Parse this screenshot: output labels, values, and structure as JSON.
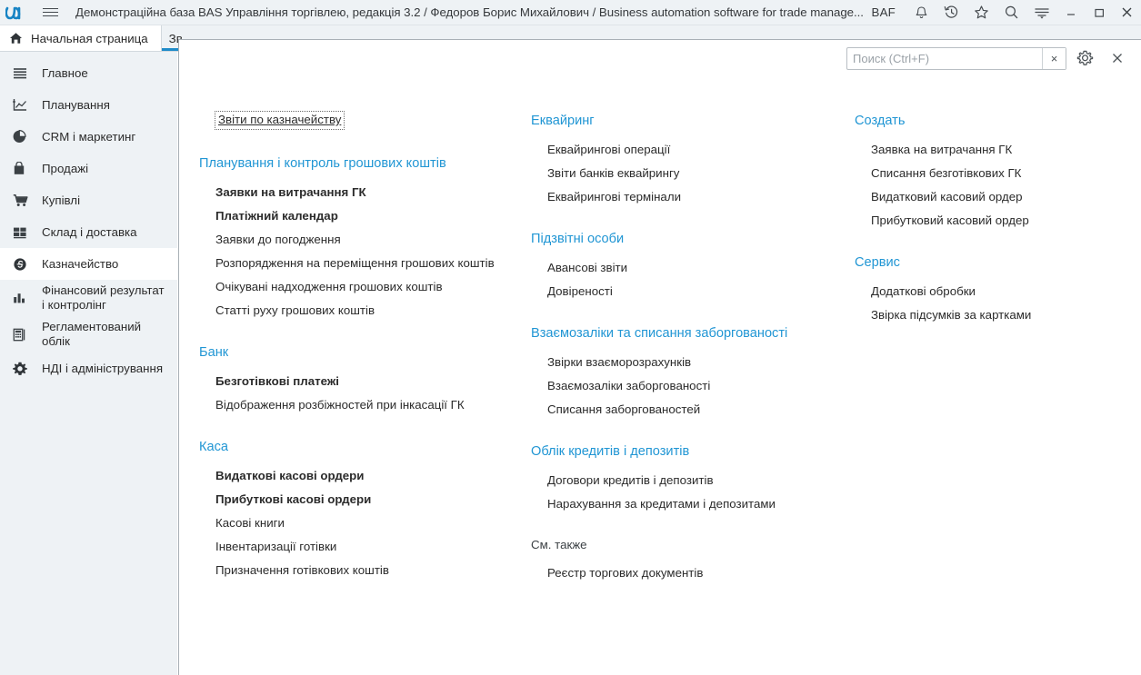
{
  "titlebar": {
    "logo_icon": "bas-logo-icon",
    "menu_icon": "hamburger-menu-icon",
    "title": "Демонстраційна база BAS Управління торгівлею, редакція 3.2 / Федоров Борис Михайлович / Business automation software for trade manage...",
    "user_initials": "BAF",
    "icons": [
      {
        "name": "notifications-bell-icon",
        "glyph": "bell"
      },
      {
        "name": "history-clock-icon",
        "glyph": "clock"
      },
      {
        "name": "favorites-star-icon",
        "glyph": "star"
      },
      {
        "name": "search-icon",
        "glyph": "search"
      },
      {
        "name": "menu-functions-icon",
        "glyph": "lines"
      }
    ],
    "window_buttons": [
      {
        "name": "minimize-button",
        "glyph": "minimize"
      },
      {
        "name": "maximize-button",
        "glyph": "maximize"
      },
      {
        "name": "close-button",
        "glyph": "close"
      }
    ]
  },
  "tabs": [
    {
      "label": "Начальная страница",
      "icon": "home-icon",
      "active": false
    },
    {
      "label": "Зв",
      "icon": "",
      "active": true
    }
  ],
  "sidebar": {
    "items": [
      {
        "label": "Главное",
        "icon": "list-lines-icon",
        "active": false
      },
      {
        "label": "Планування",
        "icon": "chart-trend-icon",
        "active": false
      },
      {
        "label": "CRM і маркетинг",
        "icon": "pie-chart-icon",
        "active": false
      },
      {
        "label": "Продажі",
        "icon": "shopping-bag-icon",
        "active": false
      },
      {
        "label": "Купівлі",
        "icon": "shopping-cart-icon",
        "active": false
      },
      {
        "label": "Склад і доставка",
        "icon": "grid-blocks-icon",
        "active": false
      },
      {
        "label": "Казначейство",
        "icon": "currency-coin-icon",
        "active": true
      },
      {
        "label": "Фінансовий результат і контролінг",
        "icon": "bar-chart-icon",
        "active": false
      },
      {
        "label": "Регламентований облік",
        "icon": "calculator-icon",
        "active": false
      },
      {
        "label": "НДІ і адміністрування",
        "icon": "gear-icon",
        "active": false
      }
    ]
  },
  "panel": {
    "search": {
      "placeholder": "Поиск (Ctrl+F)",
      "value": "",
      "clear_label": "×"
    },
    "settings_icon": "gear-icon",
    "close_label": "×",
    "focus_link": "Звіти по казначейству",
    "columns": [
      {
        "groups": [
          {
            "title": "Планування і контроль грошових коштів",
            "plain": false,
            "items": [
              {
                "label": "Заявки на витрачання ГК",
                "bold": true
              },
              {
                "label": "Платіжний календар",
                "bold": true
              },
              {
                "label": "Заявки до погодження",
                "bold": false
              },
              {
                "label": "Розпорядження на переміщення грошових коштів",
                "bold": false
              },
              {
                "label": "Очікувані надходження грошових коштів",
                "bold": false
              },
              {
                "label": "Статті руху грошових коштів",
                "bold": false
              }
            ]
          },
          {
            "title": "Банк",
            "plain": false,
            "items": [
              {
                "label": "Безготівкові платежі",
                "bold": true
              },
              {
                "label": "Відображення розбіжностей при інкасації ГК",
                "bold": false
              }
            ]
          },
          {
            "title": "Каса",
            "plain": false,
            "items": [
              {
                "label": "Видаткові касові ордери",
                "bold": true
              },
              {
                "label": "Прибуткові касові ордери",
                "bold": true
              },
              {
                "label": "Касові книги",
                "bold": false
              },
              {
                "label": "Інвентаризації готівки",
                "bold": false
              },
              {
                "label": "Призначення готівкових коштів",
                "bold": false
              }
            ]
          }
        ]
      },
      {
        "groups": [
          {
            "title": "Еквайринг",
            "plain": false,
            "items": [
              {
                "label": "Еквайрингові операції",
                "bold": false
              },
              {
                "label": "Звіти банків еквайрингу",
                "bold": false
              },
              {
                "label": "Еквайрингові термінали",
                "bold": false
              }
            ]
          },
          {
            "title": "Підзвітні особи",
            "plain": false,
            "items": [
              {
                "label": "Авансові звіти",
                "bold": false
              },
              {
                "label": "Довіреності",
                "bold": false
              }
            ]
          },
          {
            "title": "Взаємозаліки та списання заборгованості",
            "plain": false,
            "items": [
              {
                "label": "Звірки взаєморозрахунків",
                "bold": false
              },
              {
                "label": "Взаємозаліки заборгованості",
                "bold": false
              },
              {
                "label": "Списання заборгованостей",
                "bold": false
              }
            ]
          },
          {
            "title": "Облік кредитів і депозитів",
            "plain": false,
            "items": [
              {
                "label": "Договори кредитів і депозитів",
                "bold": false
              },
              {
                "label": "Нарахування за кредитами і депозитами",
                "bold": false
              }
            ]
          },
          {
            "title": "См. также",
            "plain": true,
            "items": [
              {
                "label": "Реєстр торгових документів",
                "bold": false
              }
            ]
          }
        ]
      },
      {
        "groups": [
          {
            "title": "Создать",
            "plain": false,
            "items": [
              {
                "label": "Заявка на витрачання ГК",
                "bold": false
              },
              {
                "label": "Списання безготівкових ГК",
                "bold": false
              },
              {
                "label": "Видатковий касовий ордер",
                "bold": false
              },
              {
                "label": "Прибутковий касовий ордер",
                "bold": false
              }
            ]
          },
          {
            "title": "Сервис",
            "plain": false,
            "items": [
              {
                "label": "Додаткові обробки",
                "bold": false
              },
              {
                "label": "Звірка підсумків за картками",
                "bold": false
              }
            ]
          }
        ]
      }
    ]
  },
  "colors": {
    "accent": "#2196d4",
    "titlebar_bg": "#eef2f5",
    "sidebar_bg": "#eef2f5",
    "text": "#2b2b2b"
  }
}
